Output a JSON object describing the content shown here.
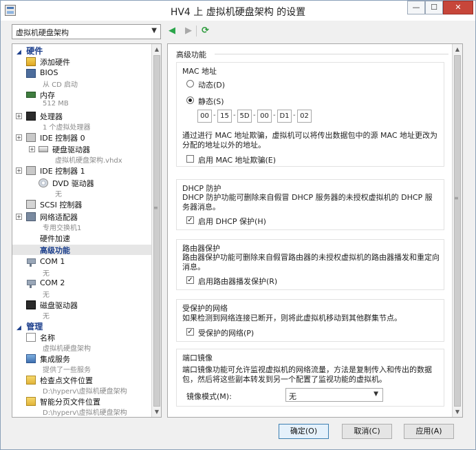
{
  "window": {
    "title": "HV4 上 虚拟机硬盘架构 的设置",
    "minimize_glyph": "—",
    "maximize_glyph": "☐",
    "close_glyph": "✕"
  },
  "nav": {
    "vm_selector": "虚拟机硬盘架构",
    "back_glyph": "◀",
    "forward_glyph": "▶",
    "refresh_glyph": "⟳"
  },
  "tree": {
    "hardware_section": "硬件",
    "management_section": "管理",
    "items": {
      "add_hw": "添加硬件",
      "bios": "BIOS",
      "bios_sub": "从 CD 启动",
      "memory": "内存",
      "memory_sub": "512 MB",
      "cpu": "处理器",
      "cpu_sub": "1 个虚拟处理器",
      "ide0": "IDE 控制器 0",
      "hdd": "硬盘驱动器",
      "hdd_sub": "虚拟机硬盘架构.vhdx",
      "ide1": "IDE 控制器 1",
      "dvd": "DVD 驱动器",
      "dvd_sub": "无",
      "scsi": "SCSI 控制器",
      "net": "网络适配器",
      "net_sub": "专用交换机1",
      "hw_accel": "硬件加速",
      "advanced": "高级功能",
      "com1": "COM 1",
      "com1_sub": "无",
      "com2": "COM 2",
      "com2_sub": "无",
      "floppy": "磁盘驱动器",
      "floppy_sub": "无",
      "name": "名称",
      "name_sub": "虚拟机硬盘架构",
      "services": "集成服务",
      "services_sub": "提供了一些服务",
      "checkpoint": "检查点文件位置",
      "checkpoint_sub": "D:\\hyperv\\虚拟机硬盘架构",
      "paging": "智能分页文件位置",
      "paging_sub": "D:\\hyperv\\虚拟机硬盘架构"
    }
  },
  "panel": {
    "title": "高级功能",
    "mac": {
      "title": "MAC 地址",
      "dynamic_label": "动态(D)",
      "static_label": "静态(S)",
      "selected": "static",
      "octets": [
        "00",
        "15",
        "5D",
        "00",
        "D1",
        "02"
      ],
      "description": "通过进行 MAC 地址欺骗，虚拟机可以将传出数据包中的源 MAC 地址更改为分配的地址以外的地址。",
      "spoofing_label": "启用 MAC 地址欺骗(E)",
      "spoofing_checked": false
    },
    "dhcp": {
      "title": "DHCP 防护",
      "description": "DHCP 防护功能可删除来自假冒 DHCP 服务器的未授权虚拟机的 DHCP 服务器消息。",
      "checkbox_label": "启用 DHCP 保护(H)",
      "checked": true
    },
    "router": {
      "title": "路由器保护",
      "description": "路由器保护功能可删除来自假冒路由器的未授权虚拟机的路由器播发和重定向消息。",
      "checkbox_label": "启用路由器播发保护(R)",
      "checked": true
    },
    "protected": {
      "title": "受保护的网络",
      "description": "如果检测到网络连接已断开，则将此虚拟机移动到其他群集节点。",
      "checkbox_label": "受保护的网络(P)",
      "checked": true
    },
    "mirror": {
      "title": "端口镜像",
      "description": "端口镜像功能可允许监视虚拟机的网络流量，方法是复制传入和传出的数据包，然后将这些副本转发到另一个配置了监视功能的虚拟机。",
      "mode_label": "镜像模式(M):",
      "mode_value": "无"
    }
  },
  "buttons": {
    "ok": "确定(O)",
    "cancel": "取消(C)",
    "apply": "应用(A)"
  },
  "glyphs": {
    "check": "✓",
    "dropdown": "▼",
    "collapse": "◢",
    "expand_plus": "+",
    "scroll_up": "▲",
    "scroll_down": "▼",
    "grip": "≡"
  },
  "colors": {
    "section_blue": "#1c3f8c",
    "close_red": "#c7463a",
    "default_button_border": "#3c7fb1"
  }
}
